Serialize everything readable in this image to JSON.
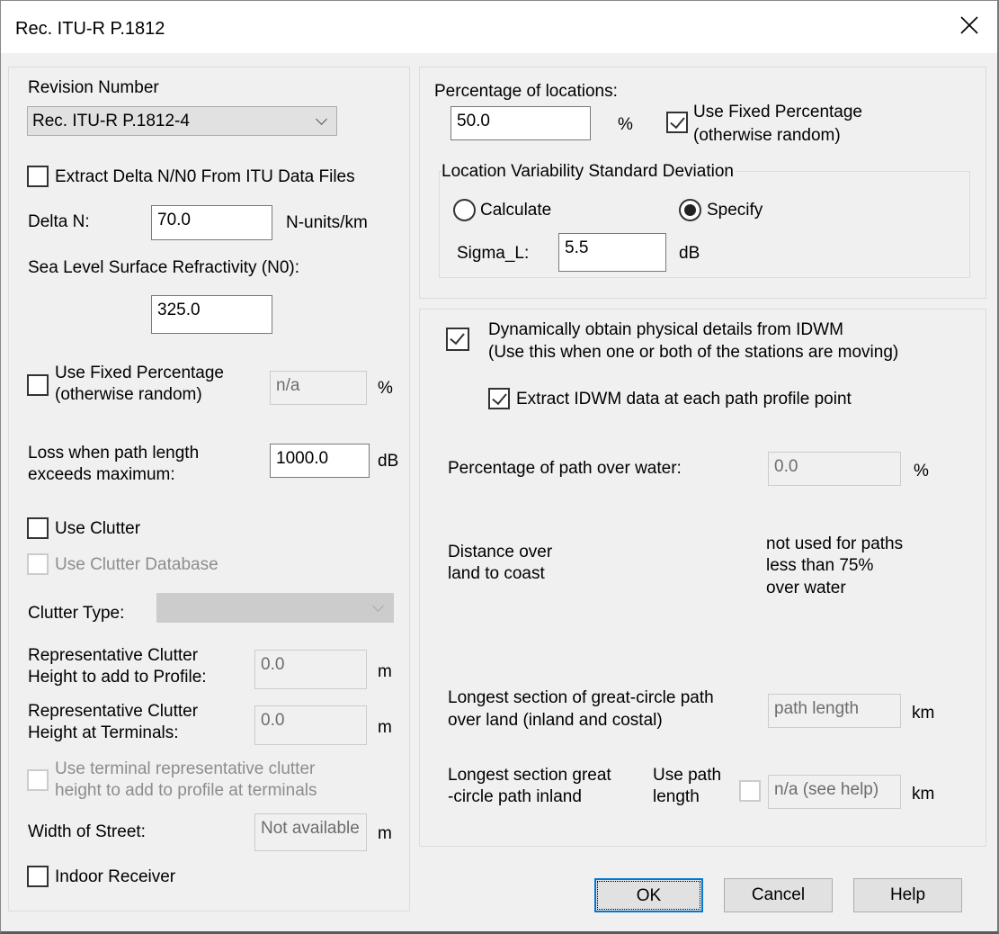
{
  "window": {
    "title": "Rec. ITU-R P.1812"
  },
  "left": {
    "revision_label": "Revision Number",
    "revision_value": "Rec. ITU-R P.1812-4",
    "extract_delta_label": "Extract Delta N/N0 From ITU Data Files",
    "extract_delta_checked": false,
    "delta_n_label": "Delta N:",
    "delta_n_value": "70.0",
    "delta_n_unit": "N-units/km",
    "n0_label": "Sea Level Surface Refractivity (N0):",
    "n0_value": "325.0",
    "fixed_pct_line1": "Use Fixed Percentage",
    "fixed_pct_line2": "(otherwise random)",
    "fixed_pct_checked": false,
    "fixed_pct_value": "n/a",
    "fixed_pct_unit": "%",
    "loss_line1": "Loss when path length",
    "loss_line2": "exceeds maximum:",
    "loss_value": "1000.0",
    "loss_unit": "dB",
    "use_clutter_label": "Use Clutter",
    "use_clutter_checked": false,
    "use_clutter_db_label": "Use Clutter Database",
    "clutter_type_label": "Clutter Type:",
    "clutter_type_value": "",
    "rep_profile_line1": "Representative Clutter",
    "rep_profile_line2": "Height to add to Profile:",
    "rep_profile_value": "0.0",
    "rep_profile_unit": "m",
    "rep_term_line1": "Representative Clutter",
    "rep_term_line2": "Height at Terminals:",
    "rep_term_value": "0.0",
    "rep_term_unit": "m",
    "use_term_line1": "Use terminal representative clutter",
    "use_term_line2": "height to add to profile at terminals",
    "street_label": "Width of Street:",
    "street_value": "Not available",
    "street_unit": "m",
    "indoor_label": "Indoor Receiver",
    "indoor_checked": false
  },
  "right_top": {
    "pct_loc_label": "Percentage of locations:",
    "pct_loc_value": "50.0",
    "pct_loc_unit": "%",
    "fixed_line1": "Use Fixed Percentage",
    "fixed_line2": "(otherwise random)",
    "fixed_checked": true,
    "group_label": "Location Variability Standard Deviation",
    "calculate_label": "Calculate",
    "specify_label": "Specify",
    "selected": "Specify",
    "sigma_label": "Sigma_L:",
    "sigma_value": "5.5",
    "sigma_unit": "dB"
  },
  "right_bottom": {
    "dyn_line1": "Dynamically obtain physical details from IDWM",
    "dyn_line2": "(Use this when one or both of the stations are moving)",
    "dyn_checked": true,
    "extract_label": "Extract IDWM data at each path profile point",
    "extract_checked": true,
    "water_label": "Percentage of path over water:",
    "water_value": "0.0",
    "water_unit": "%",
    "coast_line1": "Distance over",
    "coast_line2": "land to coast",
    "note_line1": "not used for paths",
    "note_line2": "less than 75%",
    "note_line3": "over water",
    "land_line1": "Longest section of great-circle path",
    "land_line2": "over land (inland and costal)",
    "land_value": "path length",
    "land_unit": "km",
    "inland_line1": "Longest section great",
    "inland_line2": "-circle path inland",
    "use_path_line1": "Use path",
    "use_path_line2": "length",
    "inland_value": "n/a (see help)",
    "inland_unit": "km"
  },
  "buttons": {
    "ok": "OK",
    "cancel": "Cancel",
    "help": "Help"
  }
}
